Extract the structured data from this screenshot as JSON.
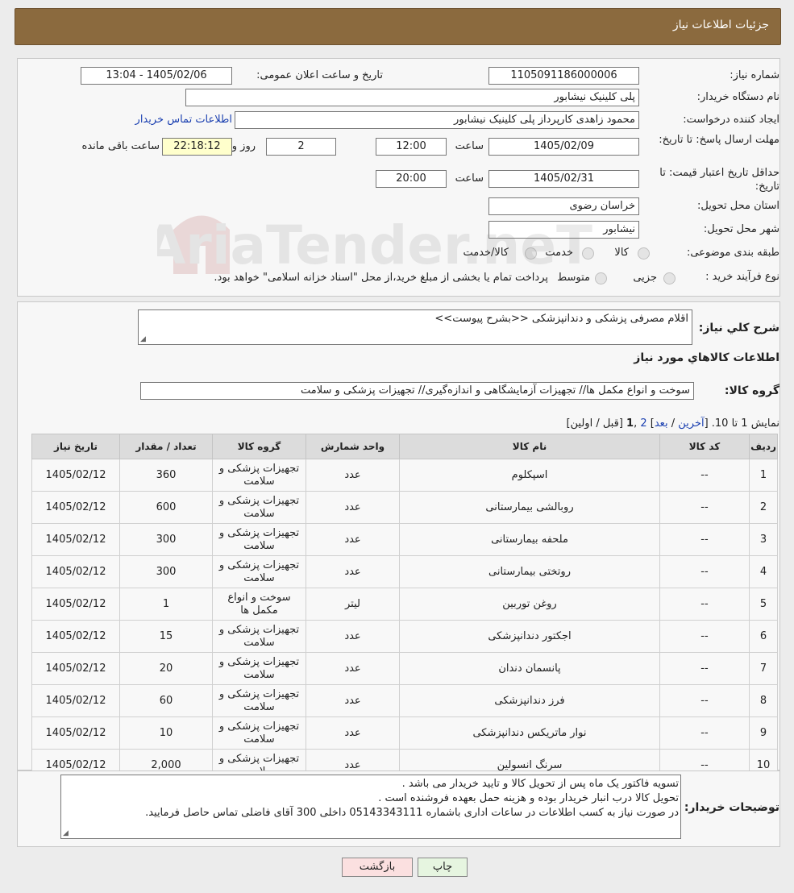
{
  "header": {
    "title": "جزئیات اطلاعات نیاز"
  },
  "form": {
    "need_number_label": "شماره نیاز:",
    "need_number": "1105091186000006",
    "announce_label": "تاریخ و ساعت اعلان عمومی:",
    "announce_value": "1405/02/06 - 13:04",
    "buyer_org_label": "نام دستگاه خریدار:",
    "buyer_org": "پلی کلینیک نیشابور",
    "requester_label": "ایجاد کننده درخواست:",
    "requester": "محمود زاهدی کارپرداز پلی کلینیک نیشابور",
    "contact_link": "اطلاعات تماس خریدار",
    "reply_deadline_label": "مهلت ارسال پاسخ: تا تاریخ:",
    "reply_date": "1405/02/09",
    "time_label": "ساعت",
    "reply_time": "12:00",
    "days_value": "2",
    "days_label": "روز و",
    "remaining_value": "22:18:12",
    "remaining_label": "ساعت باقی مانده",
    "price_validity_label": "حداقل تاریخ اعتبار قیمت: تا تاریخ:",
    "price_date": "1405/02/31",
    "price_time": "20:00",
    "province_label": "استان محل تحویل:",
    "province": "خراسان رضوی",
    "city_label": "شهر محل تحویل:",
    "city": "نیشابور",
    "category_label": "طبقه بندی موضوعی:",
    "category_options": [
      "کالا",
      "خدمت",
      "کالا/خدمت"
    ],
    "process_label": "نوع فرآیند خرید :",
    "process_options": [
      "جزیی",
      "متوسط"
    ],
    "process_note": "پرداخت تمام یا بخشی از مبلغ خرید،از محل \"اسناد خزانه اسلامی\" خواهد بود."
  },
  "watermark": {
    "text": "AriaTender.neT"
  },
  "summary": {
    "label": "شرح کلي نياز:",
    "value": "اقلام مصرفی پزشکی و دندانپزشکی <<بشرح پیوست>>",
    "items_title": "اطلاعات کالاهاي مورد نياز",
    "group_label": "گروه کالا:",
    "group_value": "سوخت و انواع مکمل ها// تجهیزات آزمایشگاهی و اندازه‌گیری// تجهیزات پزشکی و سلامت",
    "pager_prefix": "نمایش 1 تا 10. [",
    "pager_last": "آخرین",
    "pager_sep1": " / ",
    "pager_next": "بعد",
    "pager_sep2": "] ",
    "pager_page2": "2",
    "pager_sep3": " ,",
    "pager_page1": "1",
    "pager_suffix": " [قبل / اولین]"
  },
  "table": {
    "headers": [
      "ردیف",
      "کد کالا",
      "نام کالا",
      "واحد شمارش",
      "گروه کالا",
      "تعداد / مقدار",
      "تاریخ نیاز"
    ],
    "rows": [
      [
        "1",
        "--",
        "اسپکلوم",
        "عدد",
        "تجهیزات پزشکی و سلامت",
        "360",
        "1405/02/12"
      ],
      [
        "2",
        "--",
        "روبالشی بیمارستانی",
        "عدد",
        "تجهیزات پزشکی و سلامت",
        "600",
        "1405/02/12"
      ],
      [
        "3",
        "--",
        "ملحفه بیمارستانی",
        "عدد",
        "تجهیزات پزشکی و سلامت",
        "300",
        "1405/02/12"
      ],
      [
        "4",
        "--",
        "روتختی بیمارستانی",
        "عدد",
        "تجهیزات پزشکی و سلامت",
        "300",
        "1405/02/12"
      ],
      [
        "5",
        "--",
        "روغن توربین",
        "لیتر",
        "سوخت و انواع مکمل ها",
        "1",
        "1405/02/12"
      ],
      [
        "6",
        "--",
        "اجکتور دندانپزشکی",
        "عدد",
        "تجهیزات پزشکی و سلامت",
        "15",
        "1405/02/12"
      ],
      [
        "7",
        "--",
        "پانسمان دندان",
        "عدد",
        "تجهیزات پزشکی و سلامت",
        "20",
        "1405/02/12"
      ],
      [
        "8",
        "--",
        "فرز دندانپزشکی",
        "عدد",
        "تجهیزات پزشکی و سلامت",
        "60",
        "1405/02/12"
      ],
      [
        "9",
        "--",
        "نوار ماتریکس دندانپزشکی",
        "عدد",
        "تجهیزات پزشکی و سلامت",
        "10",
        "1405/02/12"
      ],
      [
        "10",
        "--",
        "سرنگ انسولین",
        "عدد",
        "تجهیزات پزشکی و سلامت",
        "2,000",
        "1405/02/12"
      ]
    ]
  },
  "notes": {
    "label": "توضیحات خریدار:",
    "lines": [
      "تسویه فاکتور یک ماه پس از تحویل کالا و تایید خریدار می باشد .",
      "تحویل کالا درب انبار خریدار بوده و هزینه حمل بعهده فروشنده است .",
      "در صورت نیاز به کسب اطلاعات در ساعات اداری باشماره 05143343111  داخلی 300 آقای فاضلی تماس حاصل فرمایید."
    ]
  },
  "buttons": {
    "print": "چاپ",
    "back": "بازگشت"
  }
}
